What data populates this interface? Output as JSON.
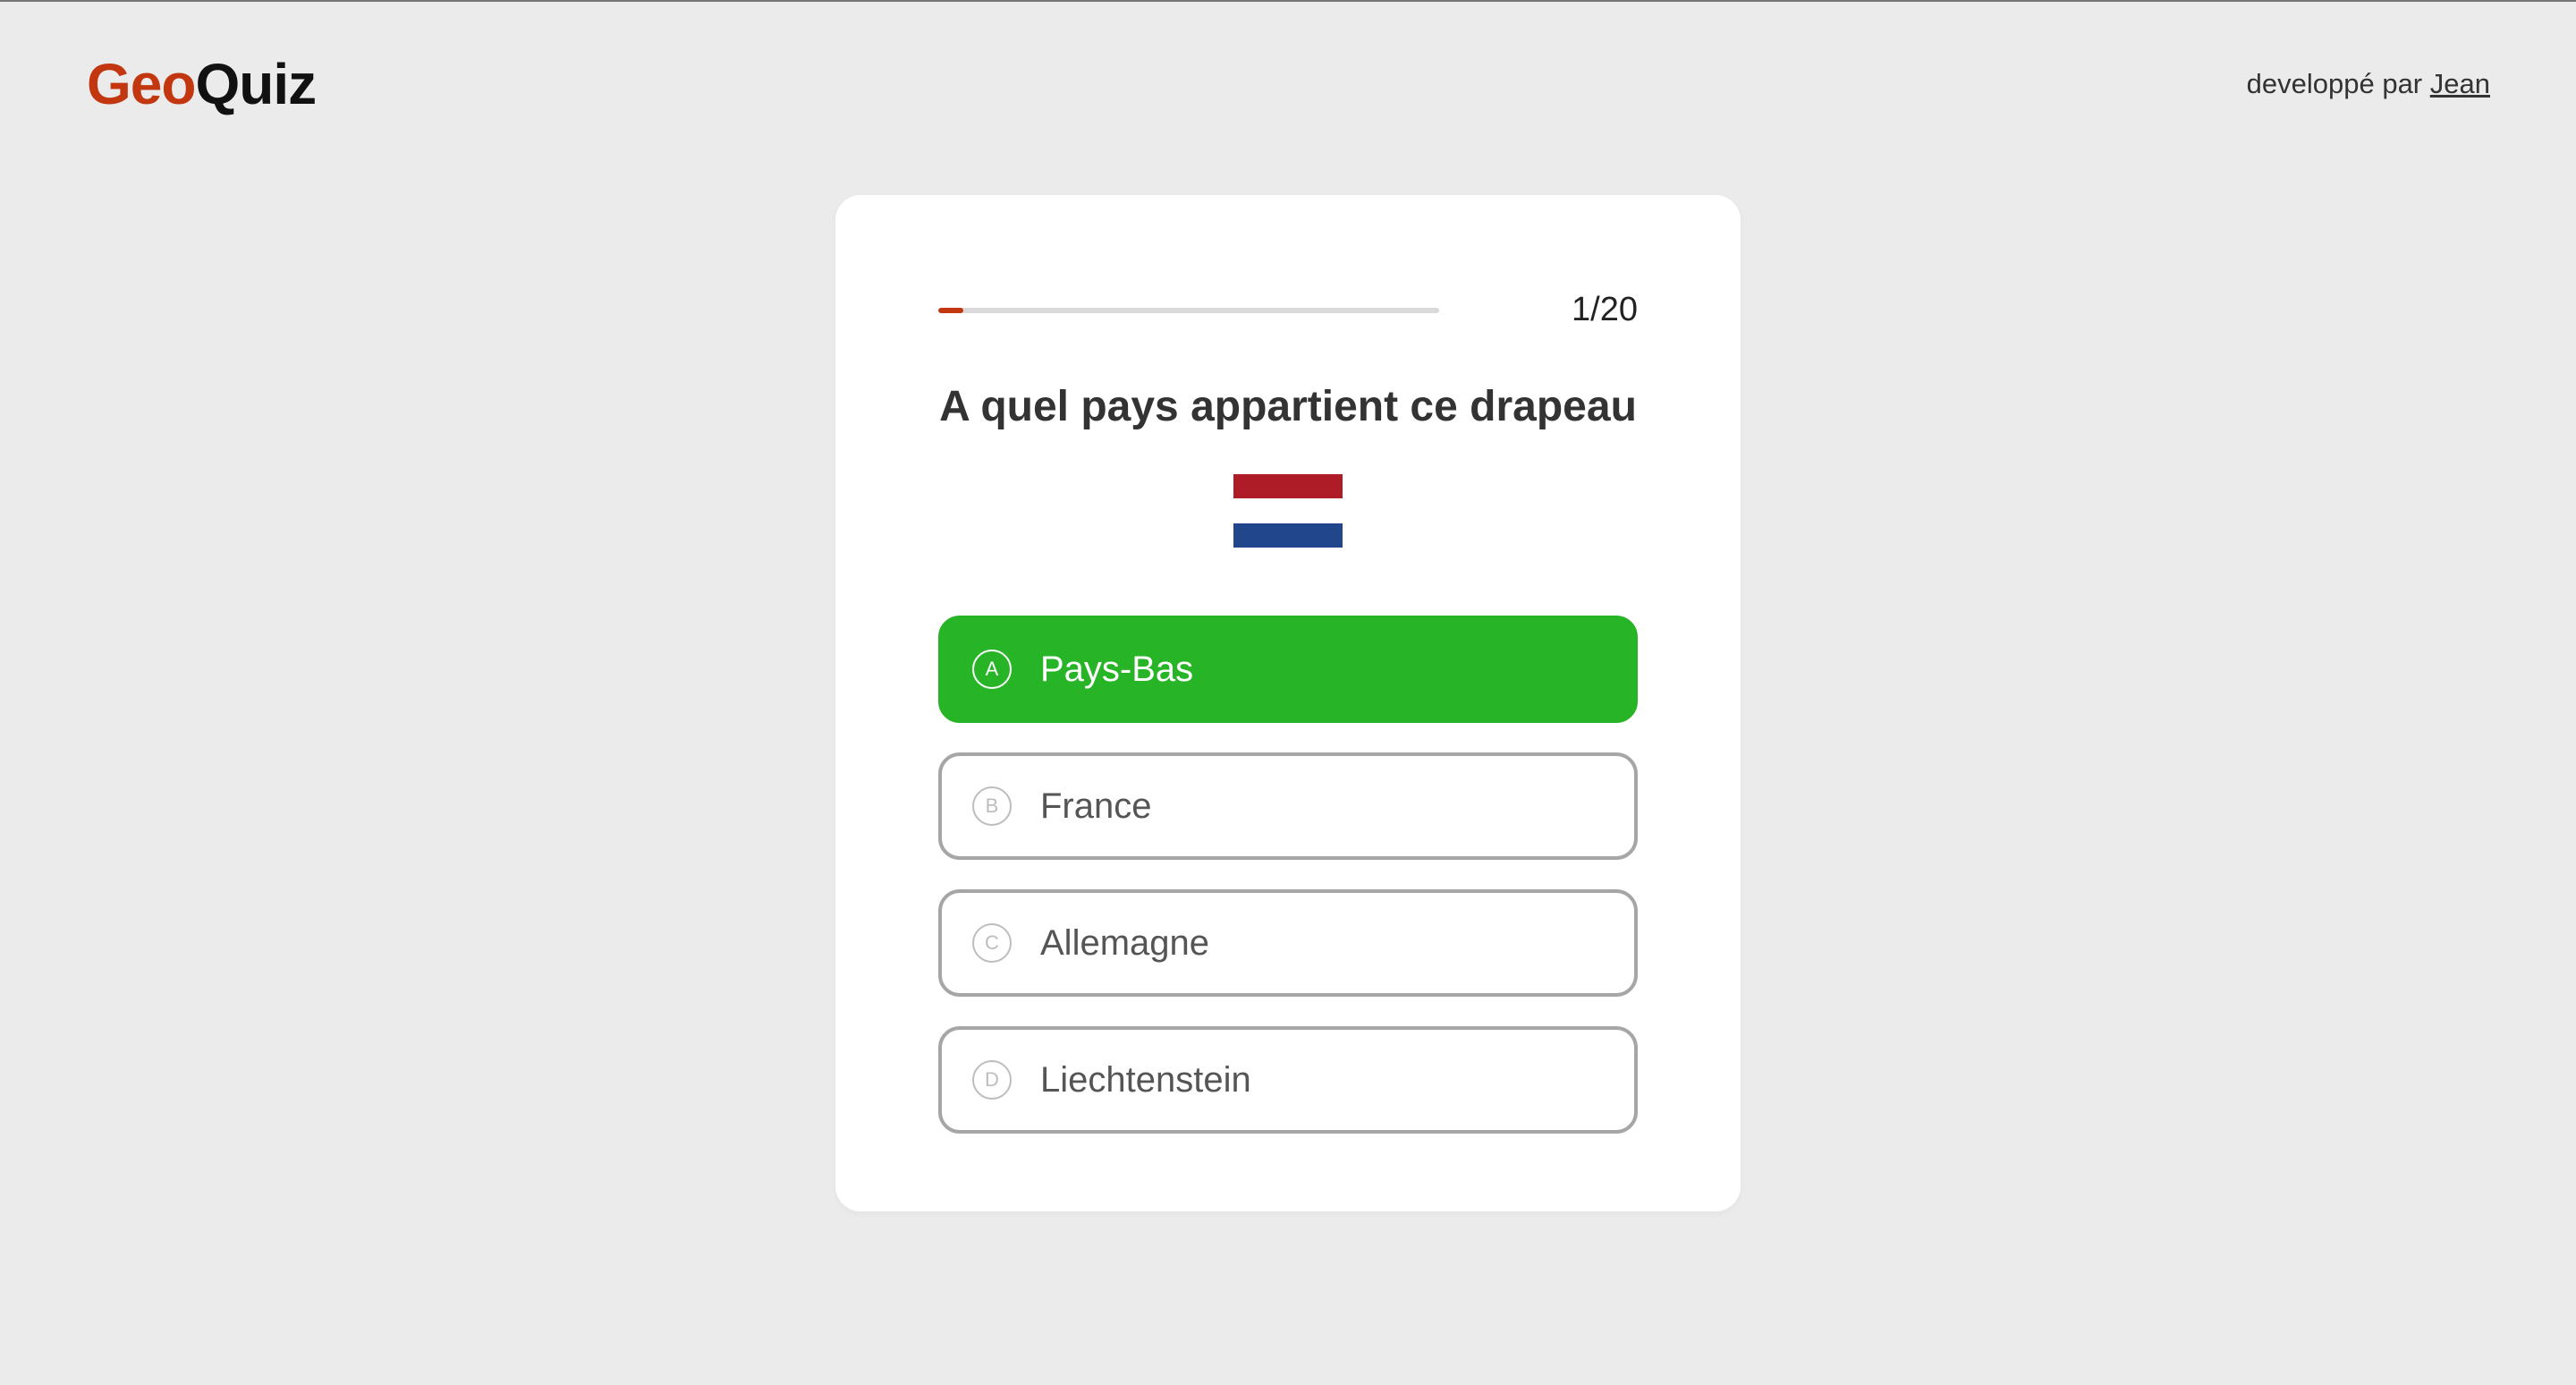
{
  "header": {
    "logo_part1": "Geo",
    "logo_part2": "Quiz",
    "credit_prefix": "developpé par",
    "credit_author": "Jean"
  },
  "quiz": {
    "counter": "1/20",
    "progress_fraction": 0.05,
    "question": "A quel pays appartient ce drapeau",
    "flag": {
      "country_shown": "Netherlands",
      "stripes": [
        "#ae1c28",
        "#ffffff",
        "#21468b"
      ]
    },
    "answers": [
      {
        "letter": "A",
        "label": "Pays-Bas",
        "state": "correct"
      },
      {
        "letter": "B",
        "label": "France",
        "state": "default"
      },
      {
        "letter": "C",
        "label": "Allemagne",
        "state": "default"
      },
      {
        "letter": "D",
        "label": "Liechtenstein",
        "state": "default"
      }
    ]
  },
  "colors": {
    "brand": "#c2370f",
    "correct": "#27b427",
    "background": "#ebebeb",
    "card": "#ffffff"
  }
}
